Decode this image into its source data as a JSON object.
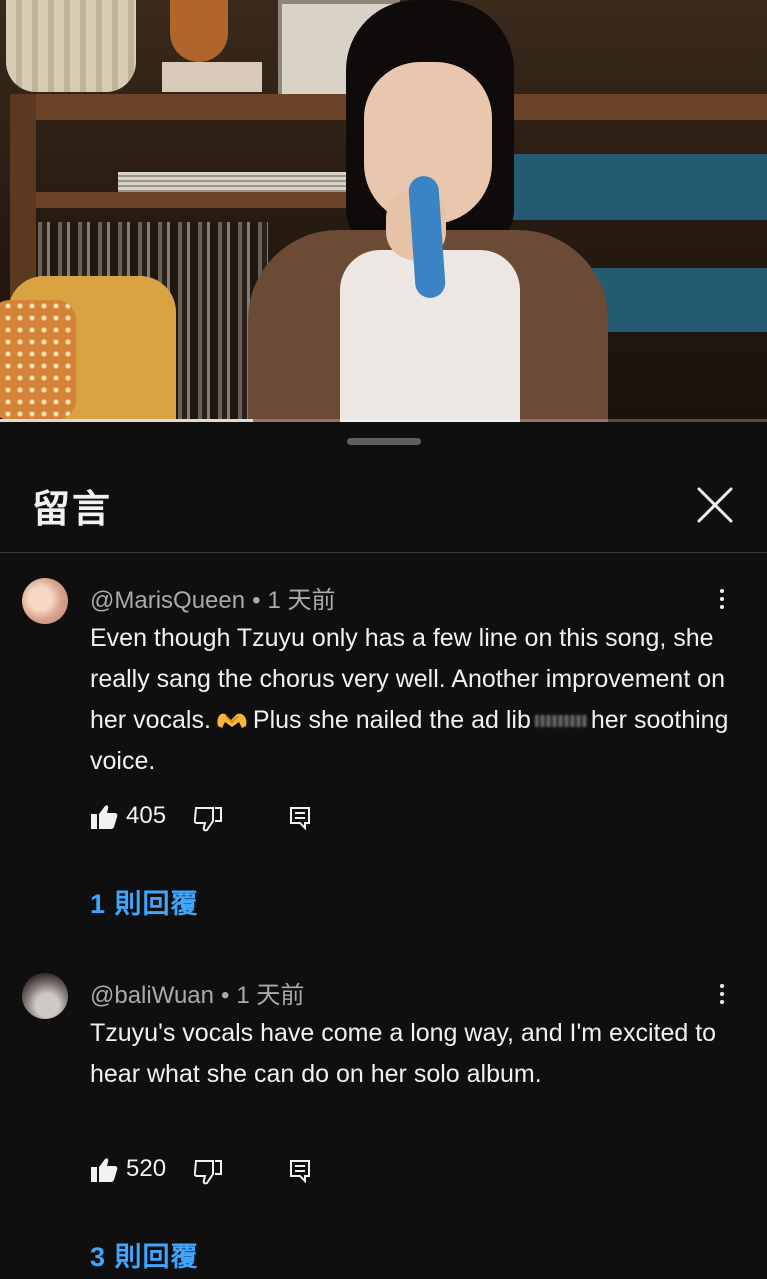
{
  "video": {
    "progress_fraction": 0.33
  },
  "sheet": {
    "title": "留言"
  },
  "comments": [
    {
      "author": "@MarisQueen",
      "time": "1 天前",
      "text_parts": [
        "Even though Tzuyu only has a few line on this song, she really sang the chorus very well. Another improvement on her vocals.",
        "Plus she nailed the ad lib",
        "her soothing voice."
      ],
      "emoji": "heart-hands-emoji",
      "likes": "405",
      "replies": "1 則回覆"
    },
    {
      "author": "@baliWuan",
      "time": "1 天前",
      "text": "Tzuyu's vocals have come a long way, and I'm excited to hear what she can do on her solo album.",
      "likes": "520",
      "replies": "3 則回覆"
    }
  ],
  "colors": {
    "background": "#0f0f0f",
    "link": "#3ea6ff",
    "meta": "#aaaaaa"
  }
}
